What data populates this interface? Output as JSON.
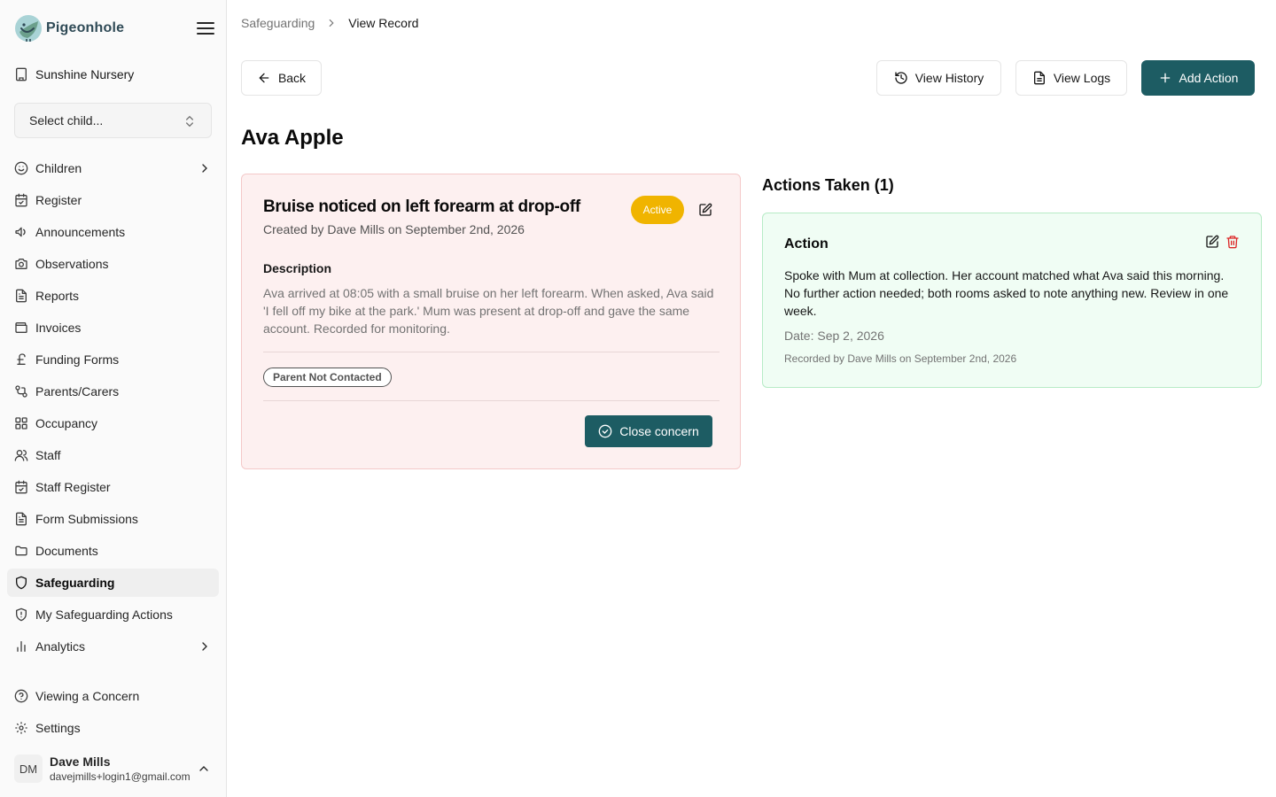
{
  "app": {
    "name": "Pigeonhole"
  },
  "org": {
    "name": "Sunshine Nursery"
  },
  "child_select": {
    "placeholder": "Select child..."
  },
  "nav": {
    "items": [
      {
        "label": "Children",
        "icon": "smile-icon",
        "has_chevron": true
      },
      {
        "label": "Register",
        "icon": "calendar-check-icon"
      },
      {
        "label": "Announcements",
        "icon": "megaphone-icon"
      },
      {
        "label": "Observations",
        "icon": "camera-icon"
      },
      {
        "label": "Reports",
        "icon": "file-text-icon"
      },
      {
        "label": "Invoices",
        "icon": "wallet-icon"
      },
      {
        "label": "Funding Forms",
        "icon": "pound-icon"
      },
      {
        "label": "Parents/Carers",
        "icon": "git-pull-icon"
      },
      {
        "label": "Occupancy",
        "icon": "grid-icon"
      },
      {
        "label": "Staff",
        "icon": "users-icon"
      },
      {
        "label": "Staff Register",
        "icon": "calendar-check-icon"
      },
      {
        "label": "Form Submissions",
        "icon": "file-text-icon"
      },
      {
        "label": "Documents",
        "icon": "folder-icon"
      },
      {
        "label": "Safeguarding",
        "icon": "shield-icon",
        "active": true
      },
      {
        "label": "My Safeguarding Actions",
        "icon": "shield-alert-icon"
      },
      {
        "label": "Analytics",
        "icon": "bar-chart-icon",
        "has_chevron": true
      }
    ],
    "bottom": [
      {
        "label": "Viewing a Concern",
        "icon": "help-circle-icon"
      },
      {
        "label": "Settings",
        "icon": "gear-icon"
      }
    ]
  },
  "user": {
    "initials": "DM",
    "name": "Dave Mills",
    "email": "davejmills+login1@gmail.com"
  },
  "breadcrumb": {
    "parent": "Safeguarding",
    "current": "View Record"
  },
  "toolbar": {
    "back": "Back",
    "view_history": "View History",
    "view_logs": "View Logs",
    "add_action": "Add Action"
  },
  "record": {
    "child_name": "Ava Apple"
  },
  "concern": {
    "title": "Bruise noticed on left forearm at drop-off",
    "meta": "Created by Dave Mills on September 2nd, 2026",
    "status": "Active",
    "description_label": "Description",
    "description": "Ava arrived at 08:05 with a small bruise on her left forearm. When asked, Ava said 'I fell off my bike at the park.' Mum was present at drop-off and gave the same account. Recorded for monitoring.",
    "tag": "Parent Not Contacted",
    "close_label": "Close concern"
  },
  "actions": {
    "heading": "Actions Taken (1)",
    "items": [
      {
        "title": "Action",
        "text": "Spoke with Mum at collection. Her account matched what Ava said this morning. No further action needed; both rooms asked to note anything new. Review in one week.",
        "date": "Date: Sep 2, 2026",
        "recorded": "Recorded by Dave Mills on September 2nd, 2026"
      }
    ]
  },
  "colors": {
    "primary": "#1d5c63",
    "active_badge": "#f0b400",
    "concern_bg": "#fdf0f0",
    "action_bg": "#f0fdf4",
    "delete": "#dc2626"
  }
}
